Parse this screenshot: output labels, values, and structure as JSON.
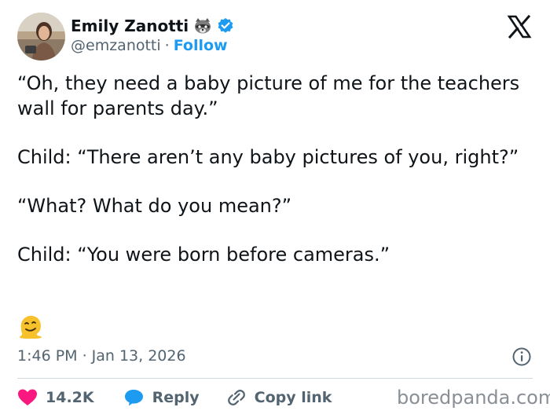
{
  "author": {
    "name": "Emily Zanotti",
    "handle": "@emzanotti",
    "separator": "·",
    "follow_label": "Follow",
    "badge_emoji": "raccoon",
    "verified": true
  },
  "tweet": {
    "paragraphs": [
      "“Oh, they need a baby picture of me for the teachers wall for parents day.”",
      "Child: “There aren’t any baby pictures of you, right?”",
      "“What? What do you mean?”",
      "Child: “You were born before cameras.”"
    ],
    "emoji": "melting-face"
  },
  "meta": {
    "time": "1:46 PM",
    "separator": "·",
    "date": "Jan 13, 2026"
  },
  "actions": {
    "likes_count": "14.2K",
    "reply_label": "Reply",
    "copy_link_label": "Copy link"
  },
  "watermark": "boredpanda.com",
  "colors": {
    "accent": "#1d9bf0",
    "like": "#f91880",
    "muted": "#536471",
    "text": "#0f1419"
  }
}
